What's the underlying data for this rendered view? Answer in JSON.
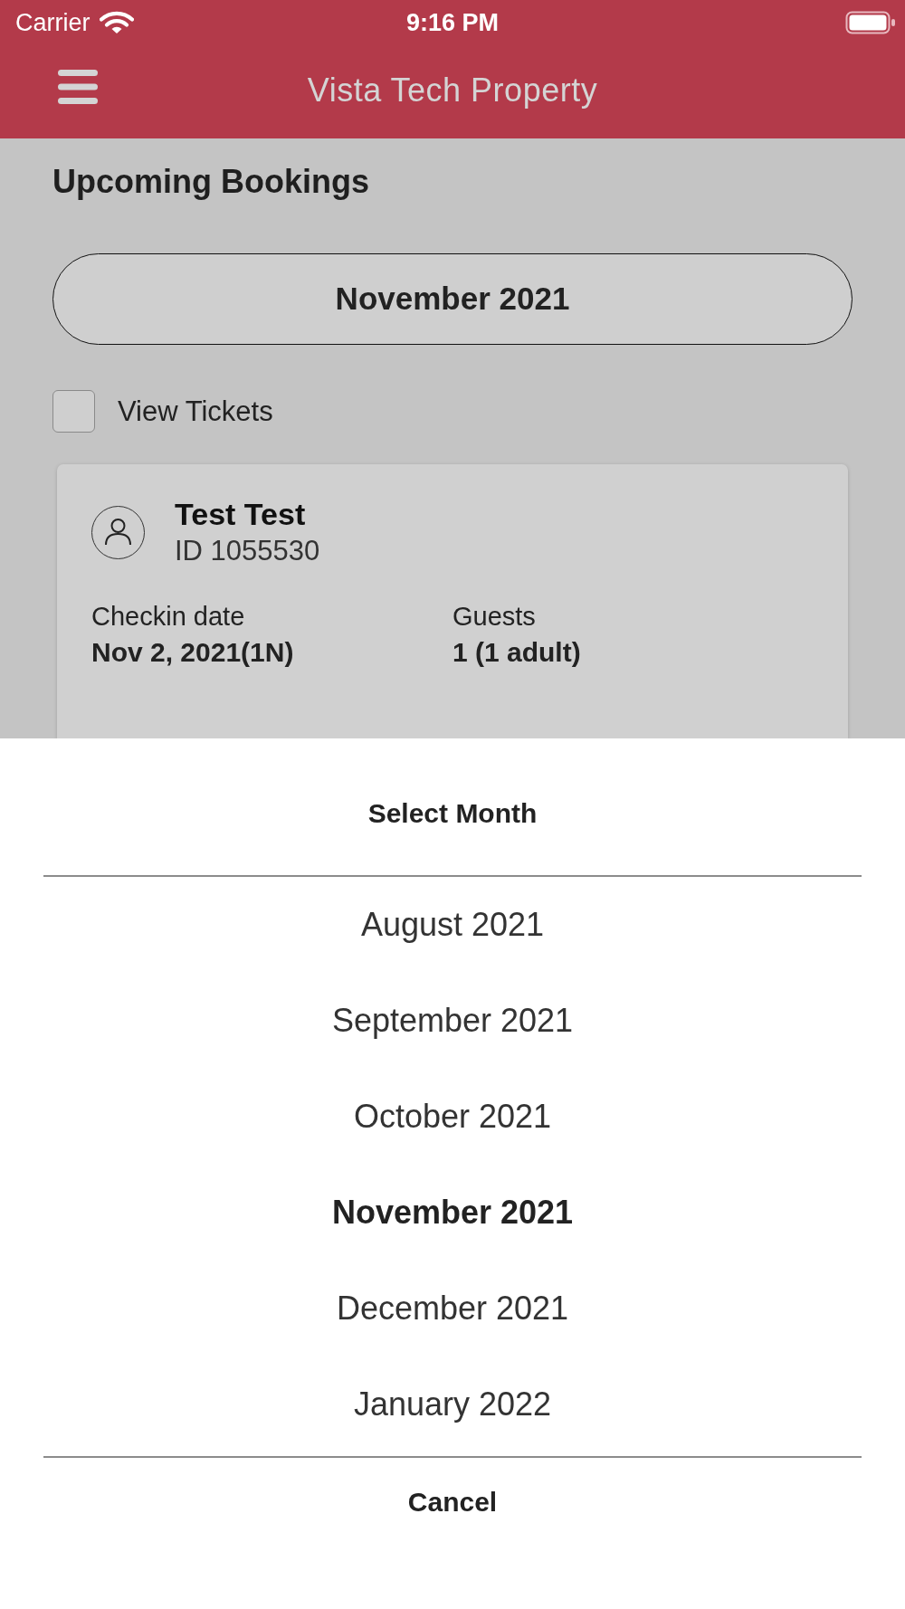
{
  "status_bar": {
    "carrier": "Carrier",
    "time": "9:16 PM"
  },
  "header": {
    "title": "Vista Tech Property"
  },
  "page": {
    "title": "Upcoming Bookings",
    "month_button": "November 2021",
    "view_tickets": {
      "label": "View Tickets",
      "checked": false
    }
  },
  "bookings": [
    {
      "name": "Test Test",
      "id": "ID 1055530",
      "fields": [
        {
          "label": "Checkin date",
          "value": "Nov 2, 2021(1N)"
        },
        {
          "label": "Guests",
          "value": "1 (1 adult)"
        }
      ]
    }
  ],
  "month_sheet": {
    "title": "Select Month",
    "options": [
      {
        "label": "August 2021",
        "selected": false
      },
      {
        "label": "September 2021",
        "selected": false
      },
      {
        "label": "October 2021",
        "selected": false
      },
      {
        "label": "November 2021",
        "selected": true
      },
      {
        "label": "December 2021",
        "selected": false
      },
      {
        "label": "January 2022",
        "selected": false
      }
    ],
    "cancel": "Cancel"
  }
}
